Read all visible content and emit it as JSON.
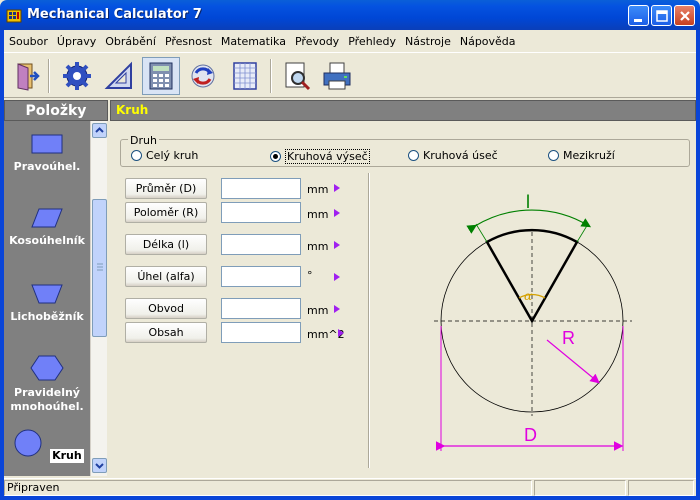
{
  "window": {
    "title": "Mechanical Calculator 7"
  },
  "menu": [
    "Soubor",
    "Úpravy",
    "Obrábění",
    "Přesnost",
    "Matematika",
    "Převody",
    "Přehledy",
    "Nástroje",
    "Nápověda"
  ],
  "sidebar": {
    "header": "Položky",
    "items": [
      {
        "label": "Pravoúhel."
      },
      {
        "label": "Kosoúhelník"
      },
      {
        "label": "Lichoběžník"
      },
      {
        "label": "Pravidelný mnohoúhel."
      },
      {
        "label": "Kruh"
      }
    ]
  },
  "section": {
    "title": "Kruh"
  },
  "druh": {
    "legend": "Druh",
    "options": [
      "Celý kruh",
      "Kruhová výseč",
      "Kruhová úseč",
      "Mezikruží"
    ],
    "selected": "Kruhová výseč"
  },
  "rows": [
    {
      "button": "Průměr (D)",
      "value": "",
      "unit": "mm"
    },
    {
      "button": "Poloměr (R)",
      "value": "",
      "unit": "mm"
    },
    {
      "button": "Délka (l)",
      "value": "",
      "unit": "mm"
    },
    {
      "button": "Úhel (alfa)",
      "value": "",
      "unit": "°"
    },
    {
      "button": "Obvod",
      "value": "",
      "unit": "mm"
    },
    {
      "button": "Obsah",
      "value": "",
      "unit": "mm^2"
    }
  ],
  "diagram": {
    "label_l": "l",
    "label_alpha": "α",
    "label_r": "R",
    "label_d": "D"
  },
  "status": {
    "text": "Připraven"
  },
  "colors": {
    "titlebar": "#0054E3",
    "panel": "#808080",
    "highlight": "#FFFF00",
    "dimension": "#E000E0",
    "arc": "#008000",
    "angle": "#D4A000"
  }
}
